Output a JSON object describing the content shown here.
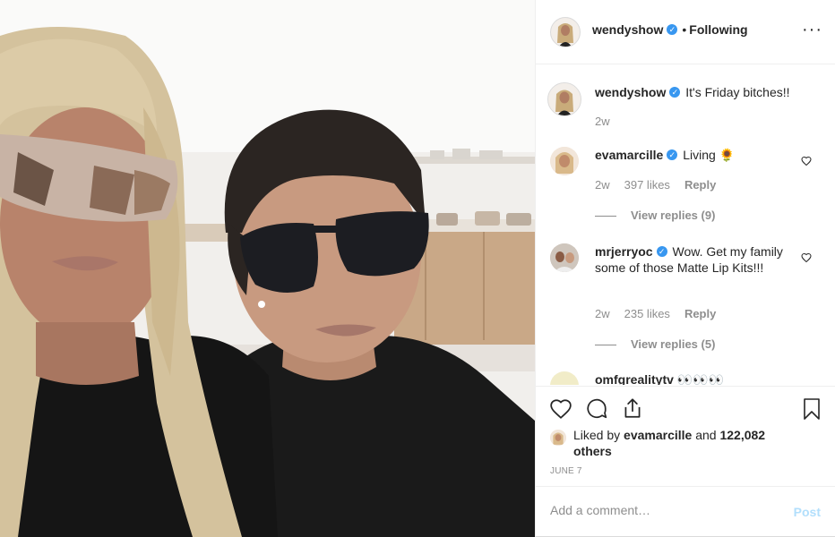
{
  "colors": {
    "accent": "#3897f0",
    "muted": "#8e8e8e",
    "text": "#262626",
    "post_disabled": "#b2dffc"
  },
  "header": {
    "username": "wendyshow",
    "separator": "•",
    "follow_status": "Following",
    "more_icon": "more-horizontal-icon"
  },
  "caption": {
    "username": "wendyshow",
    "text": "It's Friday bitches!!",
    "age": "2w"
  },
  "comments": [
    {
      "username": "evamarcille",
      "text": "Living 🌻",
      "age": "2w",
      "likes": "397 likes",
      "reply_label": "Reply",
      "view_replies": "View replies (9)"
    },
    {
      "username": "mrjerryoc",
      "text": "Wow. Get my family some of those Matte Lip Kits!!!",
      "age": "2w",
      "likes": "235 likes",
      "reply_label": "Reply",
      "view_replies": "View replies (5)"
    },
    {
      "username": "omfgrealitytv",
      "text": "👀👀👀"
    }
  ],
  "actions": {
    "like_icon": "heart-icon",
    "comment_icon": "comment-icon",
    "share_icon": "share-icon",
    "save_icon": "bookmark-icon"
  },
  "likes": {
    "prefix": "Liked by",
    "user": "evamarcille",
    "and": "and",
    "others": "122,082 others"
  },
  "date": "JUNE 7",
  "comment_input": {
    "placeholder": "Add a comment…",
    "post_label": "Post"
  }
}
